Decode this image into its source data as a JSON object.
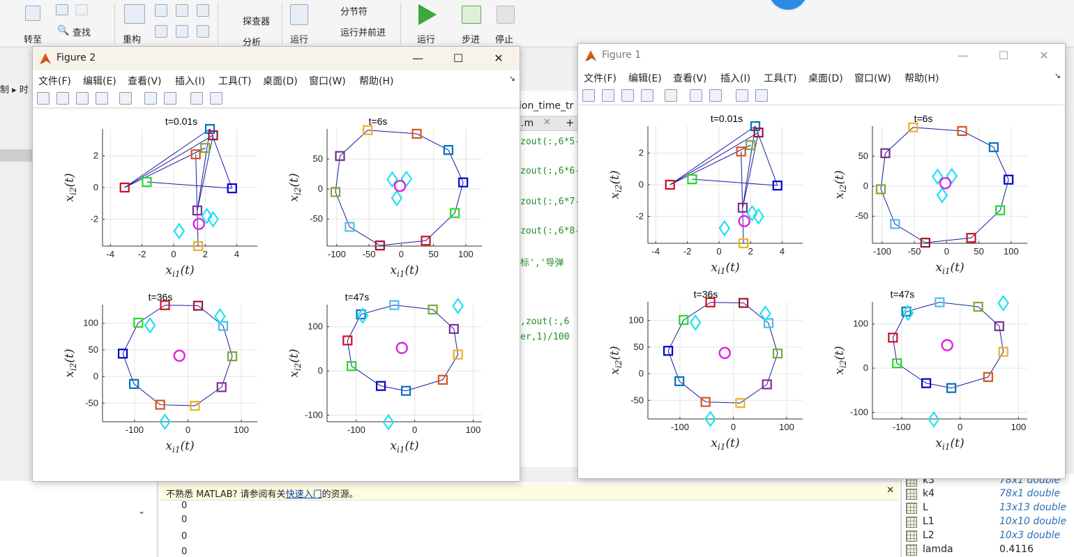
{
  "ribbon": {
    "goto": "转至",
    "find": "查找",
    "refactor": "重构",
    "explorer": "探查器",
    "analyze": "分析",
    "run": "运行",
    "section_break": "分节符",
    "run_and_advance": "运行并前进",
    "run2": "运行",
    "step": "步进",
    "stop": "停止"
  },
  "background": {
    "breadcrumb_left": "制 ▸ 时",
    "editor_tab1": "ion_time_tr",
    "editor_tab2": ".m",
    "code_lines": [
      "zout(:,6*5-",
      "zout(:,6*6-",
      "zout(:,6*7-",
      "zout(:,6*8-",
      "标','导弹",
      ",zout(:,6",
      "er,1)/100"
    ]
  },
  "notice": {
    "prefix": "不熟悉 MATLAB? 请参阅有关",
    "link": "快速入门",
    "suffix": "的资源。"
  },
  "command_output": [
    "0",
    "0",
    "0",
    "0"
  ],
  "workspace": [
    {
      "name": "k3",
      "value": "78x1 double"
    },
    {
      "name": "k4",
      "value": "78x1 double"
    },
    {
      "name": "L",
      "value": "13x13 double"
    },
    {
      "name": "L1",
      "value": "10x10 double"
    },
    {
      "name": "L2",
      "value": "10x3 double"
    },
    {
      "name": "lamda",
      "value": "0.4116"
    }
  ],
  "figure_menu": [
    "文件(F)",
    "编辑(E)",
    "查看(V)",
    "插入(I)",
    "工具(T)",
    "桌面(D)",
    "窗口(W)",
    "帮助(H)"
  ],
  "figures": [
    {
      "title": "Figure 2"
    },
    {
      "title": "Figure 1"
    }
  ],
  "colors": {
    "c1": "#0072BD",
    "c2": "#D95319",
    "c3": "#EDB120",
    "c4": "#7E2F8E",
    "c5": "#77AC30",
    "c6": "#4DBEEE",
    "c7": "#A2142F",
    "c8": "#0000CC",
    "c9": "#22DD22",
    "c10": "#CC1122",
    "missile": "#22E0F0",
    "target": "#E020E0",
    "line": "#1a1aa0"
  },
  "chart_data": [
    {
      "type": "scatter",
      "title": "t=0.01s",
      "xlim": [
        -4.5,
        5.3
      ],
      "ylim": [
        -3.7,
        3.7
      ],
      "xticks": [
        -4,
        -2,
        0,
        2,
        4
      ],
      "yticks": [
        -2,
        0,
        2
      ],
      "xlabel": "$x_{i1}(t)$",
      "ylabel": "$x_{i2}(t)$",
      "agents": [
        {
          "x": 2.3,
          "y": 3.7,
          "color": "c1"
        },
        {
          "x": 2.5,
          "y": 3.3,
          "color": "c7"
        },
        {
          "x": 2.0,
          "y": 2.5,
          "color": "c5"
        },
        {
          "x": 1.4,
          "y": 2.1,
          "color": "c2"
        },
        {
          "x": -1.7,
          "y": 0.35,
          "color": "c9"
        },
        {
          "x": -3.1,
          "y": 0.0,
          "color": "c10"
        },
        {
          "x": 3.7,
          "y": -0.05,
          "color": "c8"
        },
        {
          "x": 1.5,
          "y": -1.45,
          "color": "c4"
        },
        {
          "x": 1.55,
          "y": -3.7,
          "color": "c3"
        }
      ],
      "ring_order": null,
      "lines": [
        [
          -3.1,
          0.0,
          2.3,
          3.7
        ],
        [
          -3.1,
          0.0,
          2.5,
          3.3
        ],
        [
          -3.1,
          0.0,
          2.0,
          2.5
        ],
        [
          -1.7,
          0.35,
          3.7,
          -0.05
        ],
        [
          2.3,
          3.7,
          3.7,
          -0.05
        ],
        [
          2.5,
          3.3,
          1.5,
          -1.45
        ],
        [
          2.3,
          3.7,
          1.5,
          -1.45
        ],
        [
          1.4,
          2.1,
          1.55,
          -3.7
        ]
      ],
      "missiles": [
        {
          "x": 2.1,
          "y": -1.8
        },
        {
          "x": 2.5,
          "y": -2.0
        },
        {
          "x": 0.35,
          "y": -2.75
        }
      ],
      "target": {
        "x": 1.6,
        "y": -2.3
      }
    },
    {
      "type": "scatter",
      "title": "t=6s",
      "xlim": [
        -115,
        125
      ],
      "ylim": [
        -95,
        100
      ],
      "xticks": [
        -100,
        -50,
        0,
        50,
        100
      ],
      "yticks": [
        -50,
        0,
        50
      ],
      "xlabel": "$x_{i1}(t)$",
      "ylabel": "$x_{i2}(t)$",
      "agents": [
        {
          "x": -52,
          "y": 98,
          "color": "c3"
        },
        {
          "x": 24,
          "y": 92,
          "color": "c2"
        },
        {
          "x": 73,
          "y": 65,
          "color": "c1"
        },
        {
          "x": 96,
          "y": 11,
          "color": "c8"
        },
        {
          "x": 83,
          "y": -40,
          "color": "c9"
        },
        {
          "x": 38,
          "y": -86,
          "color": "c10"
        },
        {
          "x": -33,
          "y": -94,
          "color": "c7"
        },
        {
          "x": -80,
          "y": -63,
          "color": "c6"
        },
        {
          "x": -102,
          "y": -5,
          "color": "c5"
        },
        {
          "x": -95,
          "y": 55,
          "color": "c4"
        }
      ],
      "ring_order": [
        0,
        1,
        2,
        3,
        4,
        5,
        6,
        7,
        8,
        9
      ],
      "missiles": [
        {
          "x": -14,
          "y": 16
        },
        {
          "x": 8,
          "y": 17
        },
        {
          "x": -7,
          "y": -15
        }
      ],
      "target": {
        "x": -2,
        "y": 5
      }
    },
    {
      "type": "scatter",
      "title": "t=36s",
      "xlim": [
        -160,
        130
      ],
      "ylim": [
        -85,
        135
      ],
      "xticks": [
        -100,
        0,
        100
      ],
      "yticks": [
        -50,
        0,
        50,
        100
      ],
      "xlabel": "$x_{i1}(t)$",
      "ylabel": "$x_{i2}(t)$",
      "agents": [
        {
          "x": -43,
          "y": 134,
          "color": "c10"
        },
        {
          "x": 19,
          "y": 133,
          "color": "c7"
        },
        {
          "x": 66,
          "y": 95,
          "color": "c6"
        },
        {
          "x": 83,
          "y": 38,
          "color": "c5"
        },
        {
          "x": 63,
          "y": -20,
          "color": "c4"
        },
        {
          "x": 13,
          "y": -55,
          "color": "c3"
        },
        {
          "x": -52,
          "y": -53,
          "color": "c2"
        },
        {
          "x": -101,
          "y": -14,
          "color": "c1"
        },
        {
          "x": -122,
          "y": 43,
          "color": "c8"
        },
        {
          "x": -93,
          "y": 101,
          "color": "c9"
        }
      ],
      "ring_order": [
        0,
        1,
        2,
        3,
        4,
        5,
        6,
        7,
        8,
        9
      ],
      "missiles": [
        {
          "x": 60,
          "y": 113
        },
        {
          "x": -71,
          "y": 96
        },
        {
          "x": -43,
          "y": -85
        }
      ],
      "target": {
        "x": -16,
        "y": 39
      }
    },
    {
      "type": "scatter",
      "title": "t=47s",
      "xlim": [
        -150,
        115
      ],
      "ylim": [
        -115,
        150
      ],
      "xticks": [
        -100,
        0,
        100
      ],
      "yticks": [
        -100,
        0,
        100
      ],
      "xlabel": "$x_{i1}(t)$",
      "ylabel": "$x_{i2}(t)$",
      "agents": [
        {
          "x": -35,
          "y": 149,
          "color": "c6"
        },
        {
          "x": 31,
          "y": 139,
          "color": "c5"
        },
        {
          "x": 67,
          "y": 95,
          "color": "c4"
        },
        {
          "x": 74,
          "y": 37,
          "color": "c3"
        },
        {
          "x": 48,
          "y": -20,
          "color": "c2"
        },
        {
          "x": -15,
          "y": -45,
          "color": "c1"
        },
        {
          "x": -58,
          "y": -34,
          "color": "c8"
        },
        {
          "x": -108,
          "y": 11,
          "color": "c9"
        },
        {
          "x": -115,
          "y": 69,
          "color": "c10"
        },
        {
          "x": -92,
          "y": 128,
          "color": "c1"
        }
      ],
      "ring_order": [
        0,
        1,
        2,
        3,
        4,
        5,
        6,
        7,
        8,
        9
      ],
      "missiles": [
        {
          "x": 74,
          "y": 147
        },
        {
          "x": -89,
          "y": 125
        },
        {
          "x": -45,
          "y": -116
        }
      ],
      "target": {
        "x": -22,
        "y": 52
      }
    }
  ]
}
